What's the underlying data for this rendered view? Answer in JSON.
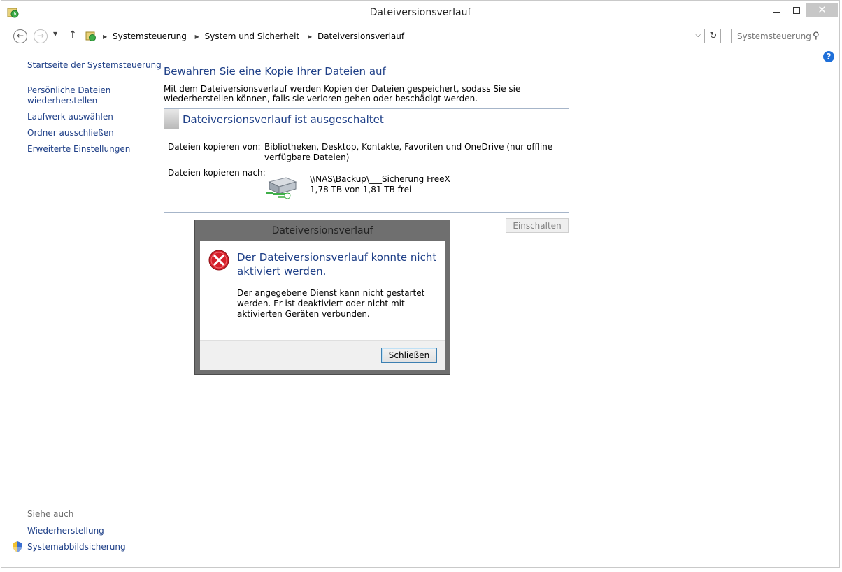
{
  "window": {
    "title": "Dateiversionsverlauf",
    "close_glyph": "✕"
  },
  "address": {
    "crumbs": [
      "Systemsteuerung",
      "System und Sicherheit",
      "Dateiversionsverlauf"
    ],
    "search_placeholder": "Systemsteuerung..."
  },
  "sidebar": {
    "home": "Startseite der Systemsteuerung",
    "restore_line1": "Persönliche Dateien",
    "restore_line2": "wiederherstellen",
    "select_drive": "Laufwerk auswählen",
    "exclude_folders": "Ordner ausschließen",
    "advanced": "Erweiterte Einstellungen",
    "see_also": "Siehe auch",
    "recovery": "Wiederherstellung",
    "system_image": "Systemabbildsicherung"
  },
  "main": {
    "title": "Bewahren Sie eine Kopie Ihrer Dateien auf",
    "description": "Mit dem Dateiversionsverlauf werden Kopien der Dateien gespeichert, sodass Sie sie wiederherstellen können, falls sie verloren gehen oder beschädigt werden.",
    "status_title": "Dateiversionsverlauf ist ausgeschaltet",
    "copy_from_label": "Dateien kopieren von:",
    "copy_from_value": "Bibliotheken, Desktop, Kontakte, Favoriten und OneDrive (nur offline verfügbare Dateien)",
    "copy_to_label": "Dateien kopieren nach:",
    "drive_path": "\\\\NAS\\Backup\\___Sicherung FreeX",
    "drive_space": "1,78 TB von 1,81 TB frei",
    "enable_button": "Einschalten"
  },
  "dialog": {
    "title": "Dateiversionsverlauf",
    "heading": "Der Dateiversionsverlauf konnte nicht aktiviert werden.",
    "message": "Der angegebene Dienst kann nicht gestartet werden. Er ist deaktiviert oder nicht mit aktivierten Geräten verbunden.",
    "close_button": "Schließen"
  },
  "colors": {
    "link": "#1e3f87",
    "error_red": "#d4202a",
    "help_blue": "#1e6fd9"
  }
}
